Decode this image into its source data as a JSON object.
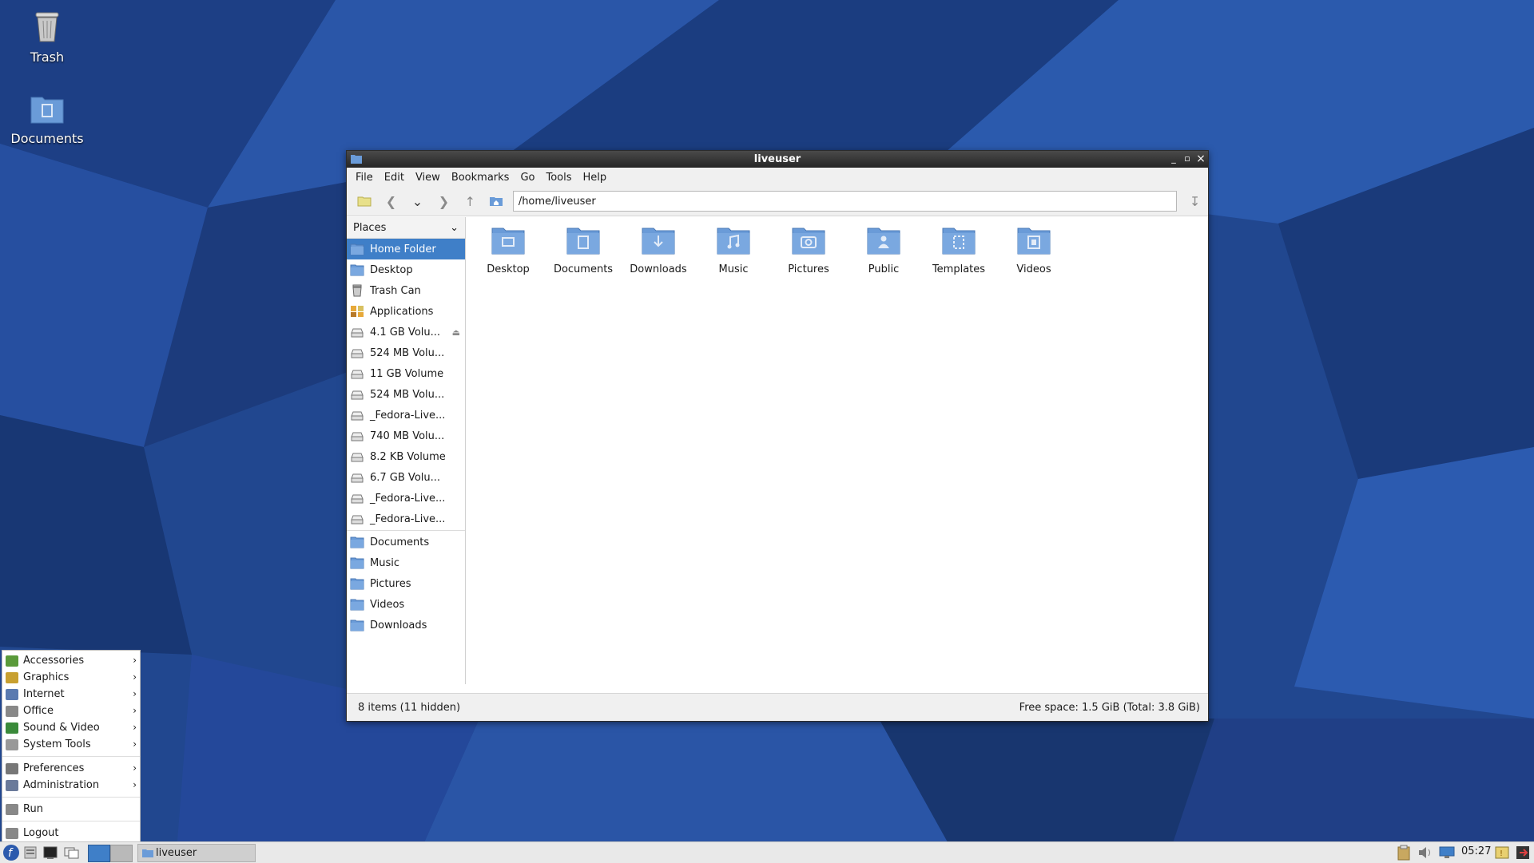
{
  "desktop": {
    "icons": [
      {
        "label": "Trash",
        "icon": "trash-icon"
      },
      {
        "label": "Documents",
        "icon": "folder-documents-icon"
      }
    ]
  },
  "window": {
    "title": "liveuser",
    "controls": {
      "minimize": "_",
      "maximize": "▫",
      "close": "×"
    },
    "menu": [
      "File",
      "Edit",
      "View",
      "Bookmarks",
      "Go",
      "Tools",
      "Help"
    ],
    "path": "/home/liveuser",
    "places_label": "Places",
    "sidebar": [
      {
        "label": "Home Folder",
        "icon": "home-folder-icon",
        "selected": true
      },
      {
        "label": "Desktop",
        "icon": "desktop-folder-icon"
      },
      {
        "label": "Trash Can",
        "icon": "trash-icon"
      },
      {
        "label": "Applications",
        "icon": "applications-icon"
      },
      {
        "label": "4.1 GB Volu...",
        "icon": "drive-icon",
        "eject": true
      },
      {
        "label": "524 MB Volu...",
        "icon": "drive-icon"
      },
      {
        "label": "11 GB Volume",
        "icon": "drive-icon"
      },
      {
        "label": "524 MB Volu...",
        "icon": "drive-icon"
      },
      {
        "label": "_Fedora-Live...",
        "icon": "drive-icon"
      },
      {
        "label": "740 MB Volu...",
        "icon": "drive-icon"
      },
      {
        "label": "8.2 KB Volume",
        "icon": "drive-icon"
      },
      {
        "label": "6.7 GB Volu...",
        "icon": "drive-icon"
      },
      {
        "label": "_Fedora-Live...",
        "icon": "drive-icon"
      },
      {
        "label": "_Fedora-Live...",
        "icon": "drive-icon"
      }
    ],
    "bookmarks": [
      {
        "label": "Documents",
        "icon": "folder-documents-icon"
      },
      {
        "label": "Music",
        "icon": "folder-music-icon"
      },
      {
        "label": "Pictures",
        "icon": "folder-pictures-icon"
      },
      {
        "label": "Videos",
        "icon": "folder-videos-icon"
      },
      {
        "label": "Downloads",
        "icon": "folder-downloads-icon"
      }
    ],
    "files": [
      {
        "label": "Desktop",
        "icon": "folder-desktop-icon"
      },
      {
        "label": "Documents",
        "icon": "folder-documents-icon"
      },
      {
        "label": "Downloads",
        "icon": "folder-downloads-icon"
      },
      {
        "label": "Music",
        "icon": "folder-music-icon"
      },
      {
        "label": "Pictures",
        "icon": "folder-pictures-icon"
      },
      {
        "label": "Public",
        "icon": "folder-public-icon"
      },
      {
        "label": "Templates",
        "icon": "folder-templates-icon"
      },
      {
        "label": "Videos",
        "icon": "folder-videos-icon"
      }
    ],
    "status_left": "8 items (11 hidden)",
    "status_right": "Free space: 1.5 GiB (Total: 3.8 GiB)"
  },
  "app_menu": {
    "items": [
      {
        "label": "Accessories",
        "icon": "accessories-icon",
        "submenu": true
      },
      {
        "label": "Graphics",
        "icon": "graphics-icon",
        "submenu": true
      },
      {
        "label": "Internet",
        "icon": "internet-icon",
        "submenu": true
      },
      {
        "label": "Office",
        "icon": "office-icon",
        "submenu": true
      },
      {
        "label": "Sound & Video",
        "icon": "sound-video-icon",
        "submenu": true
      },
      {
        "label": "System Tools",
        "icon": "system-tools-icon",
        "submenu": true
      }
    ],
    "items2": [
      {
        "label": "Preferences",
        "icon": "preferences-icon",
        "submenu": true
      },
      {
        "label": "Administration",
        "icon": "administration-icon",
        "submenu": true
      }
    ],
    "run": "Run",
    "logout": "Logout"
  },
  "taskbar": {
    "task_label": "liveuser",
    "clock": "05:27"
  },
  "colors": {
    "accent": "#3f7fc8",
    "folder": "#6a9bd8",
    "wallpaper": "#1f4590"
  }
}
